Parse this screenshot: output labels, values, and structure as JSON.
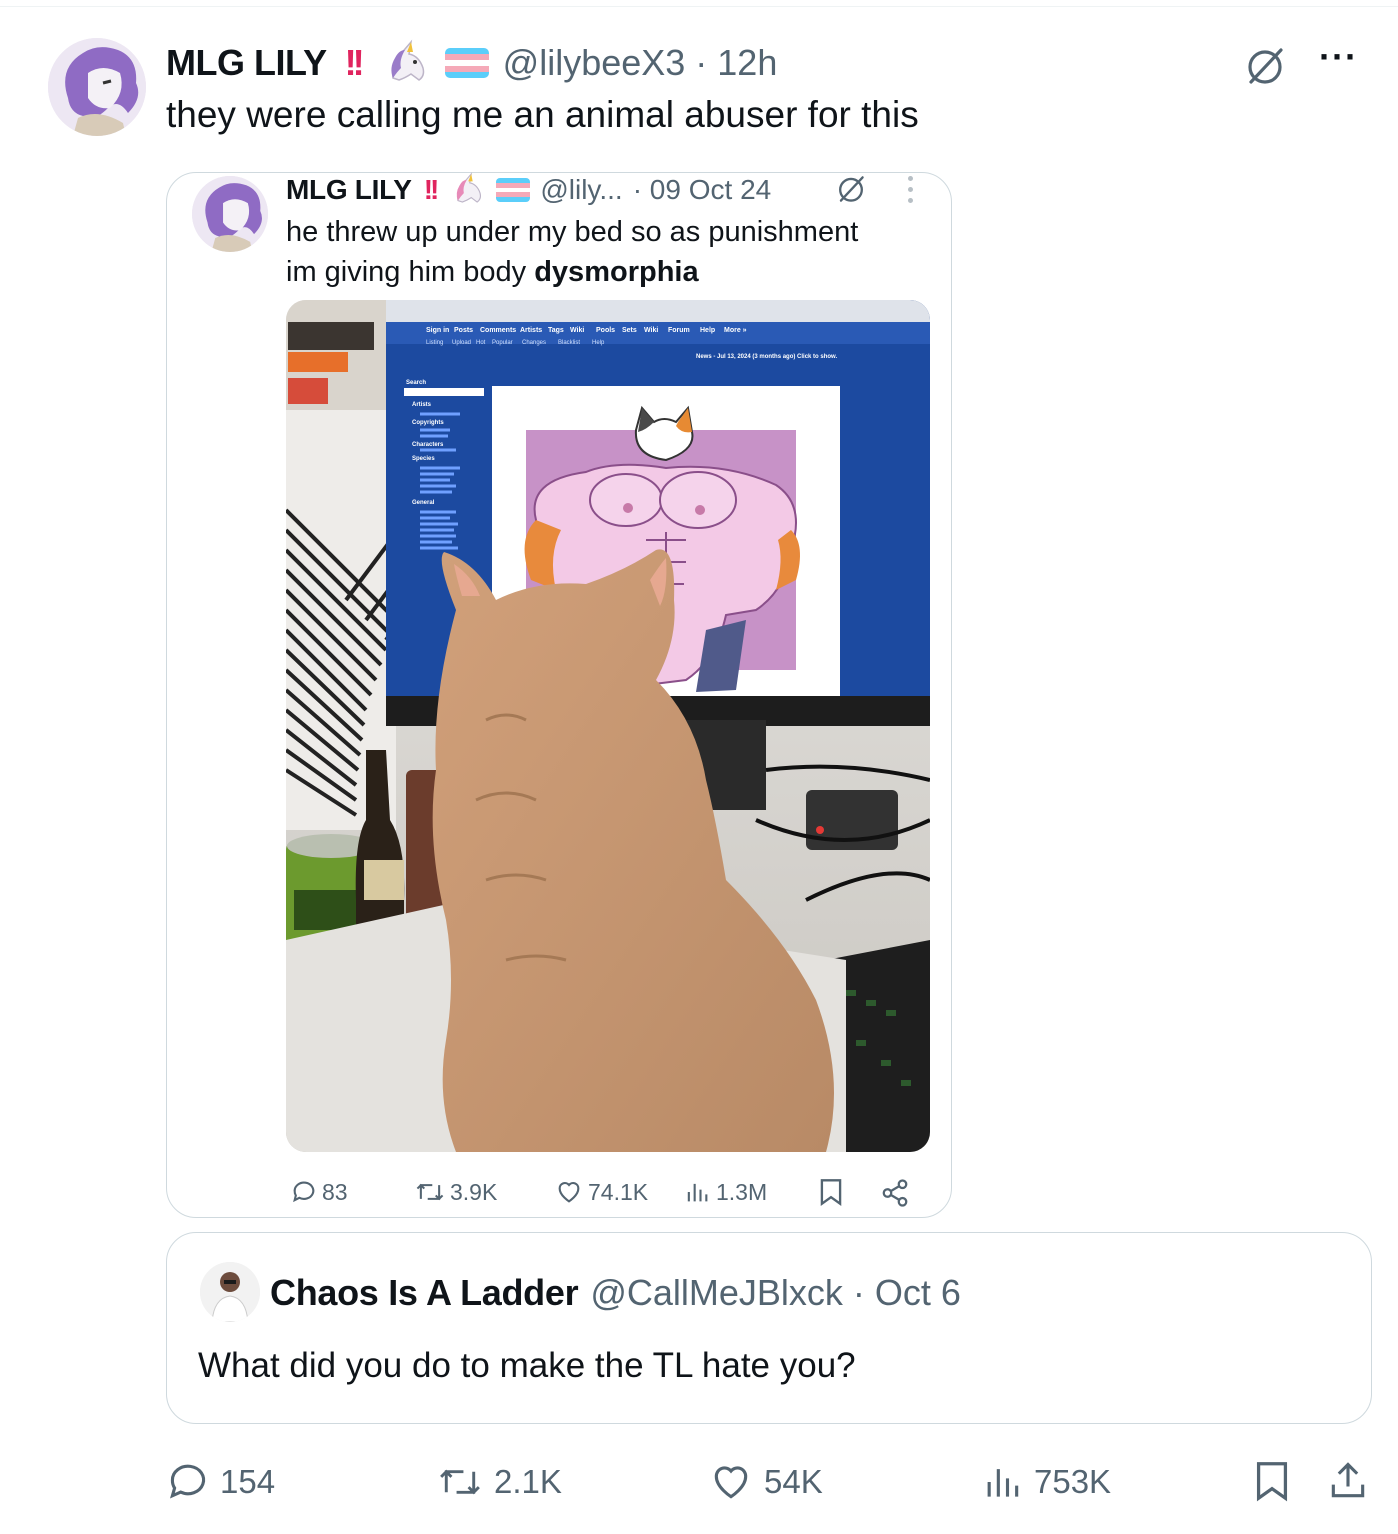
{
  "post": {
    "display_name": "MLG LILY",
    "bang": "!!",
    "unicorn": "🦄",
    "handle": "@lilybeeX3",
    "time": "· 12h",
    "text": "they were calling me an animal abuser for this"
  },
  "quoted": {
    "display_name": "MLG LILY",
    "bang": "!!",
    "unicorn": "🦄",
    "handle": "@lily...",
    "date": "· 09 Oct 24",
    "text_line1": "he threw up under my bed so as punishment",
    "text_line2_normal": "im giving him body ",
    "text_line2_bold": "dysmorphia",
    "screen": {
      "nav_row1": [
        "Sign in",
        "Posts",
        "Comments",
        "Artists",
        "Tags",
        "Wiki",
        "Pools",
        "Sets",
        "Wiki",
        "Forum",
        "Help",
        "More »"
      ],
      "nav_row2": [
        "Listing",
        "Upload",
        "Hot",
        "Popular",
        "Changes",
        "Blacklist",
        "Help"
      ],
      "news": "News - Jul 13, 2024 (3 months ago) Click to show.",
      "search_label": "Search",
      "artists_label": "Artists",
      "copyrights_label": "Copyrights",
      "characters_label": "Characters",
      "species_label": "Species",
      "general_label": "General"
    },
    "actions": {
      "replies": "83",
      "reposts": "3.9K",
      "likes": "74.1K",
      "views": "1.3M"
    }
  },
  "reply_context": {
    "display_name": "Chaos Is A Ladder",
    "handle": "@CallMeJBlxck",
    "date": "· Oct 6",
    "text": "What did you do to make the TL hate you?"
  },
  "actions": {
    "replies": "154",
    "reposts": "2.1K",
    "likes": "54K",
    "views": "753K"
  },
  "colors": {
    "text": "#0f1419",
    "secondary": "#536471",
    "border": "#cfd9de",
    "bang": "#e0245e",
    "trans_blue": "#5bcefa",
    "trans_pink": "#f5a9b8"
  }
}
